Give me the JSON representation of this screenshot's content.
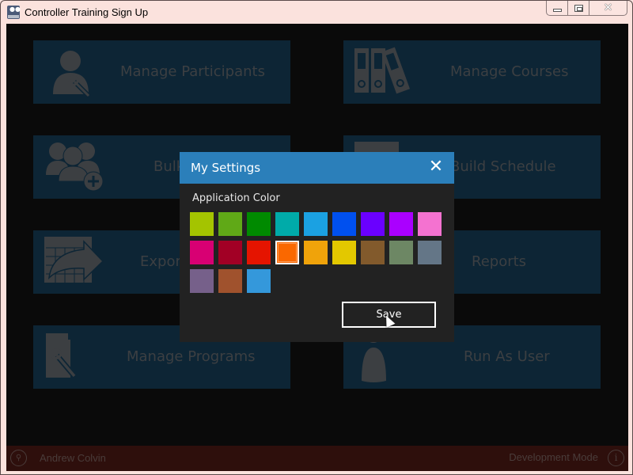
{
  "window": {
    "title": "Controller Training Sign Up",
    "app_icon": "users-app-icon",
    "controls": {
      "minimize": "minimize-icon",
      "maximize": "maximize-icon",
      "close": "close-icon"
    }
  },
  "tiles": [
    {
      "id": "manage-participants",
      "label": "Manage Participants",
      "icon": "user-wrench-icon"
    },
    {
      "id": "manage-courses",
      "label": "Manage Courses",
      "icon": "binders-icon"
    },
    {
      "id": "bulk",
      "label": "Bulk",
      "icon": "group-add-icon"
    },
    {
      "id": "build-schedule",
      "label": "Build Schedule",
      "icon": "calendar-icon"
    },
    {
      "id": "export",
      "label": "Expor",
      "icon": "table-export-icon"
    },
    {
      "id": "reports",
      "label": "Reports",
      "icon": "report-icon"
    },
    {
      "id": "manage-programs",
      "label": "Manage Programs",
      "icon": "document-wrench-icon"
    },
    {
      "id": "run-as-user",
      "label": "Run As User",
      "icon": "user-icon"
    }
  ],
  "status": {
    "user_name": "Andrew Colvin",
    "mode": "Development Mode",
    "user_icon": "key-icon",
    "info_icon": "info-icon"
  },
  "dialog": {
    "title": "My Settings",
    "section_label": "Application Color",
    "selected_color": "#fa6800",
    "colors": [
      "#a4c400",
      "#60a917",
      "#008a00",
      "#00aba9",
      "#1ba1e2",
      "#0050ef",
      "#6a00ff",
      "#aa00ff",
      "#f472d0",
      "#d80073",
      "#a20025",
      "#e51400",
      "#fa6800",
      "#f0a30a",
      "#e3c800",
      "#825a2c",
      "#6d8764",
      "#647687",
      "#76608a",
      "#a0522d",
      "#3498db"
    ],
    "save_label": "Save"
  }
}
